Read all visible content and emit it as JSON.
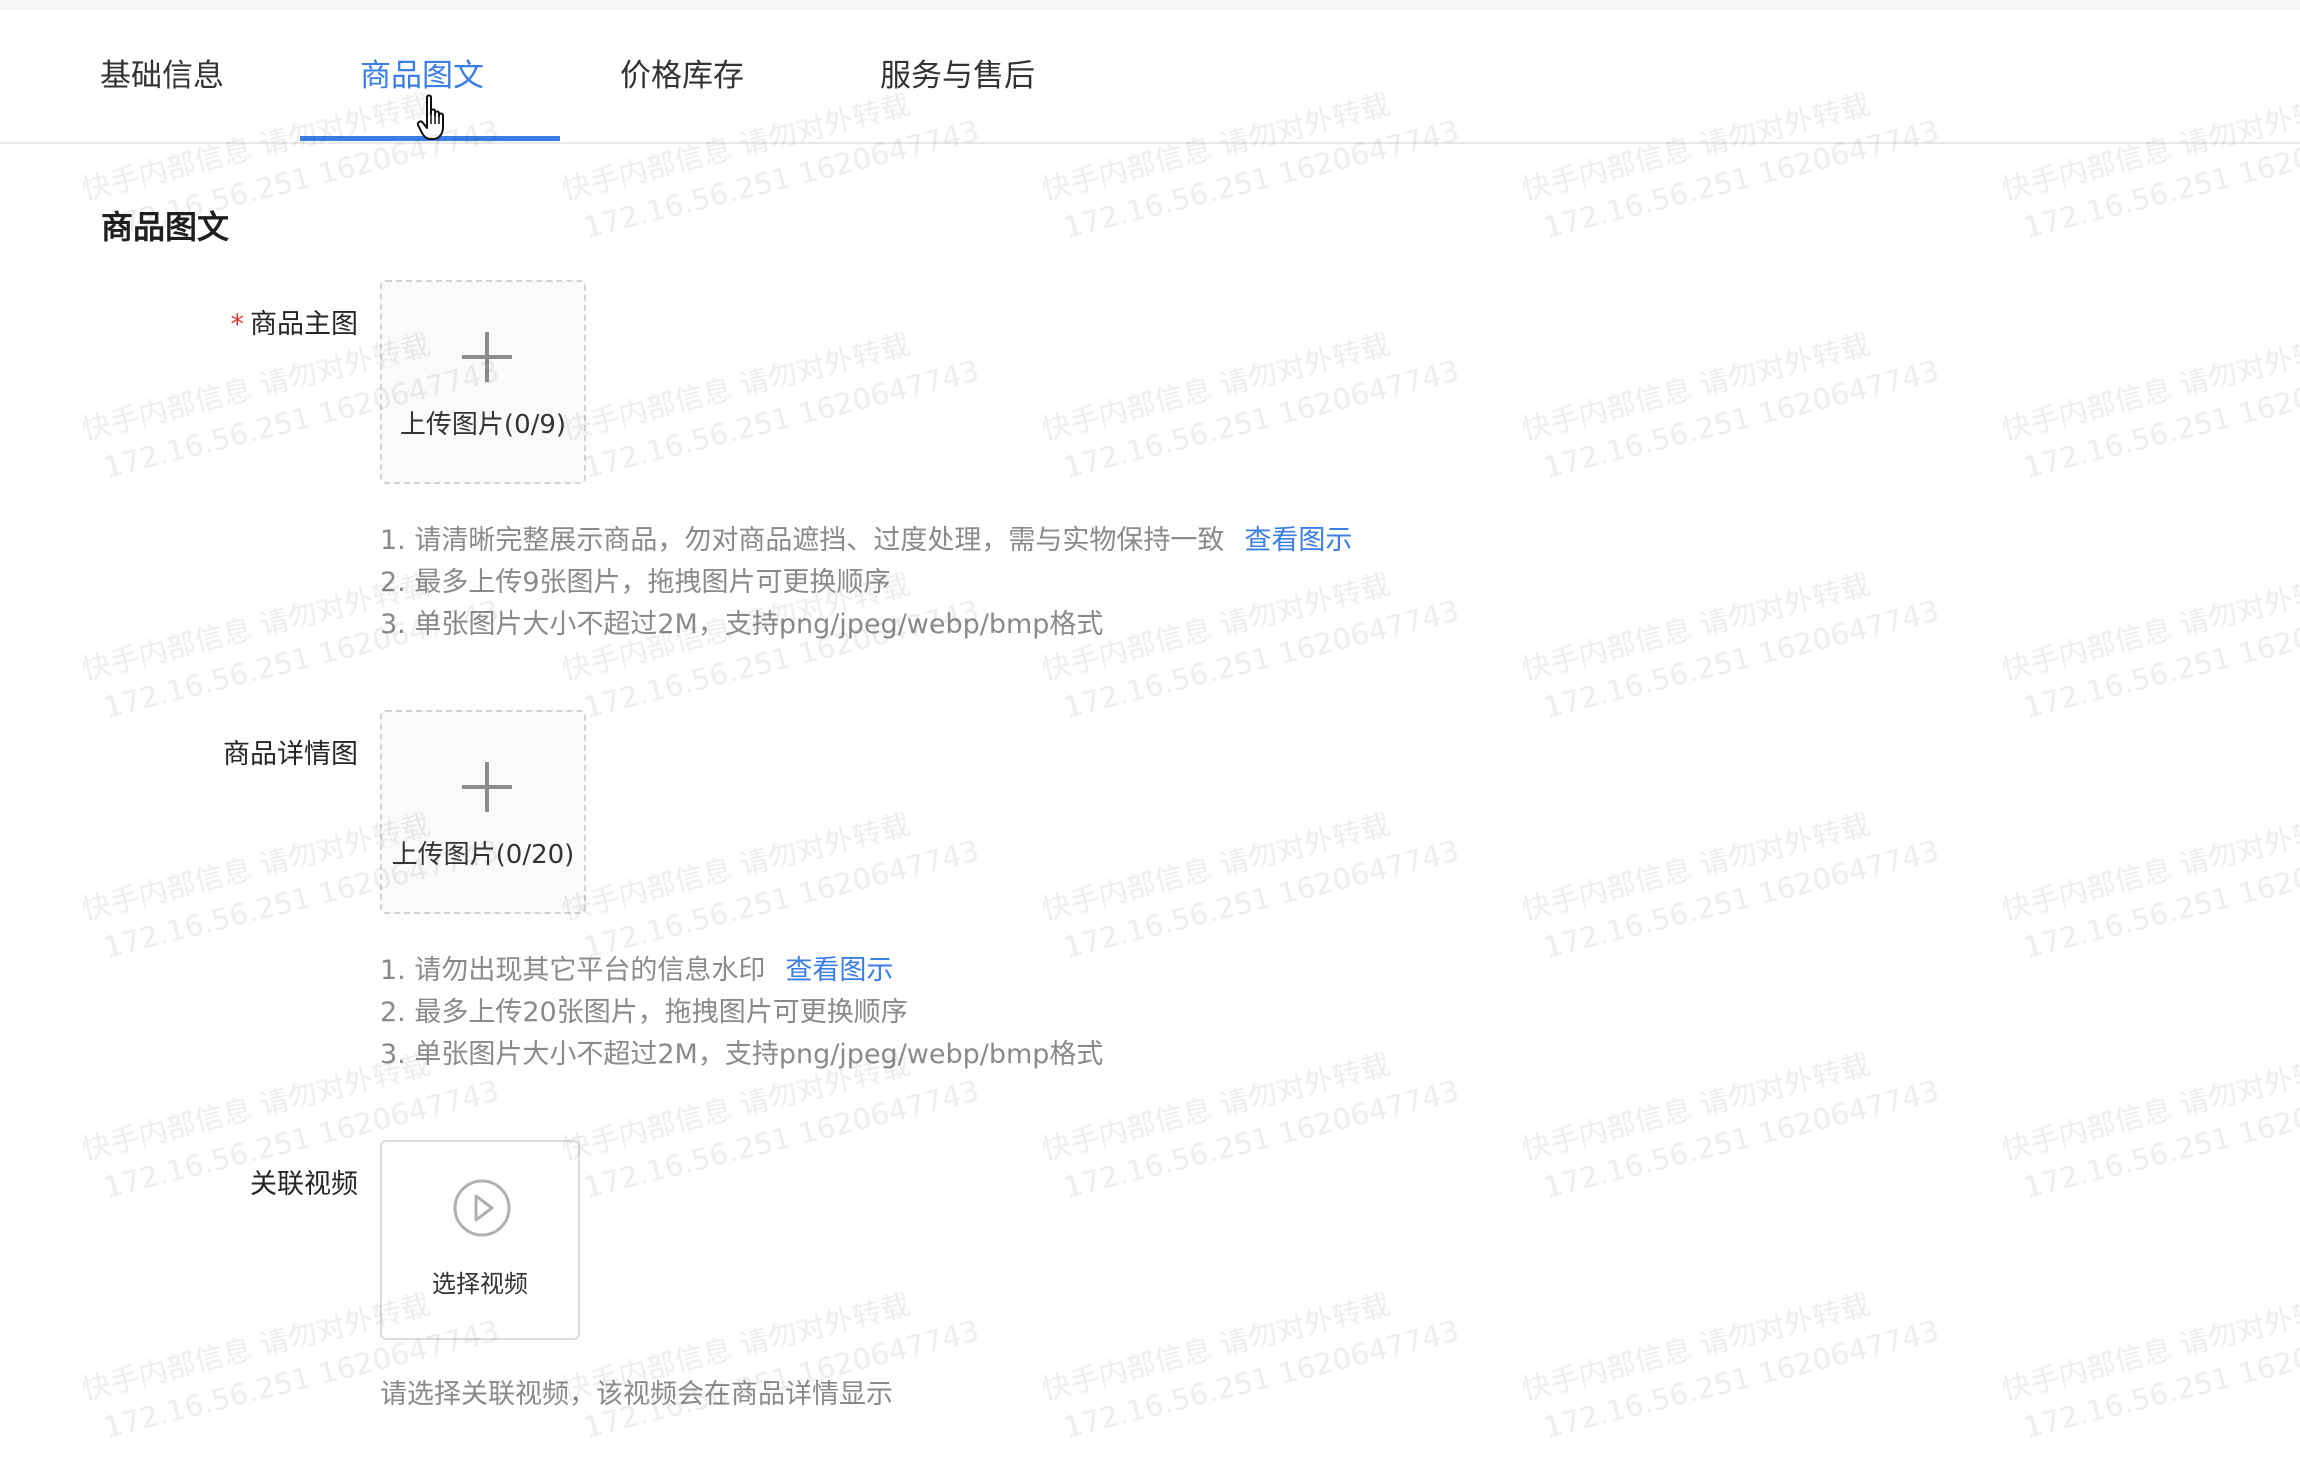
{
  "tabs": [
    {
      "label": "基础信息",
      "active": false
    },
    {
      "label": "商品图文",
      "active": true
    },
    {
      "label": "价格库存",
      "active": false
    },
    {
      "label": "服务与售后",
      "active": false
    }
  ],
  "section": {
    "title": "商品图文"
  },
  "main_image": {
    "required_mark": "*",
    "label": "商品主图",
    "upload_text": "上传图片(0/9)",
    "hints": [
      "1. 请清晰完整展示商品，勿对商品遮挡、过度处理，需与实物保持一致",
      "2. 最多上传9张图片，拖拽图片可更换顺序",
      "3. 单张图片大小不超过2M，支持png/jpeg/webp/bmp格式"
    ],
    "link": "查看图示"
  },
  "detail_image": {
    "label": "商品详情图",
    "upload_text": "上传图片(0/20)",
    "hints": [
      "1. 请勿出现其它平台的信息水印",
      "2. 最多上传20张图片，拖拽图片可更换顺序",
      "3. 单张图片大小不超过2M，支持png/jpeg/webp/bmp格式"
    ],
    "link": "查看图示"
  },
  "video": {
    "label": "关联视频",
    "select_text": "选择视频",
    "hint": "请选择关联视频，该视频会在商品详情显示"
  },
  "watermark": {
    "line1": "快手内部信息 请勿对外转载",
    "line2": "172.16.56.251 1620647743"
  },
  "colors": {
    "accent": "#3a7ee6",
    "required": "#e5352f",
    "hint": "#8a8a8a"
  }
}
